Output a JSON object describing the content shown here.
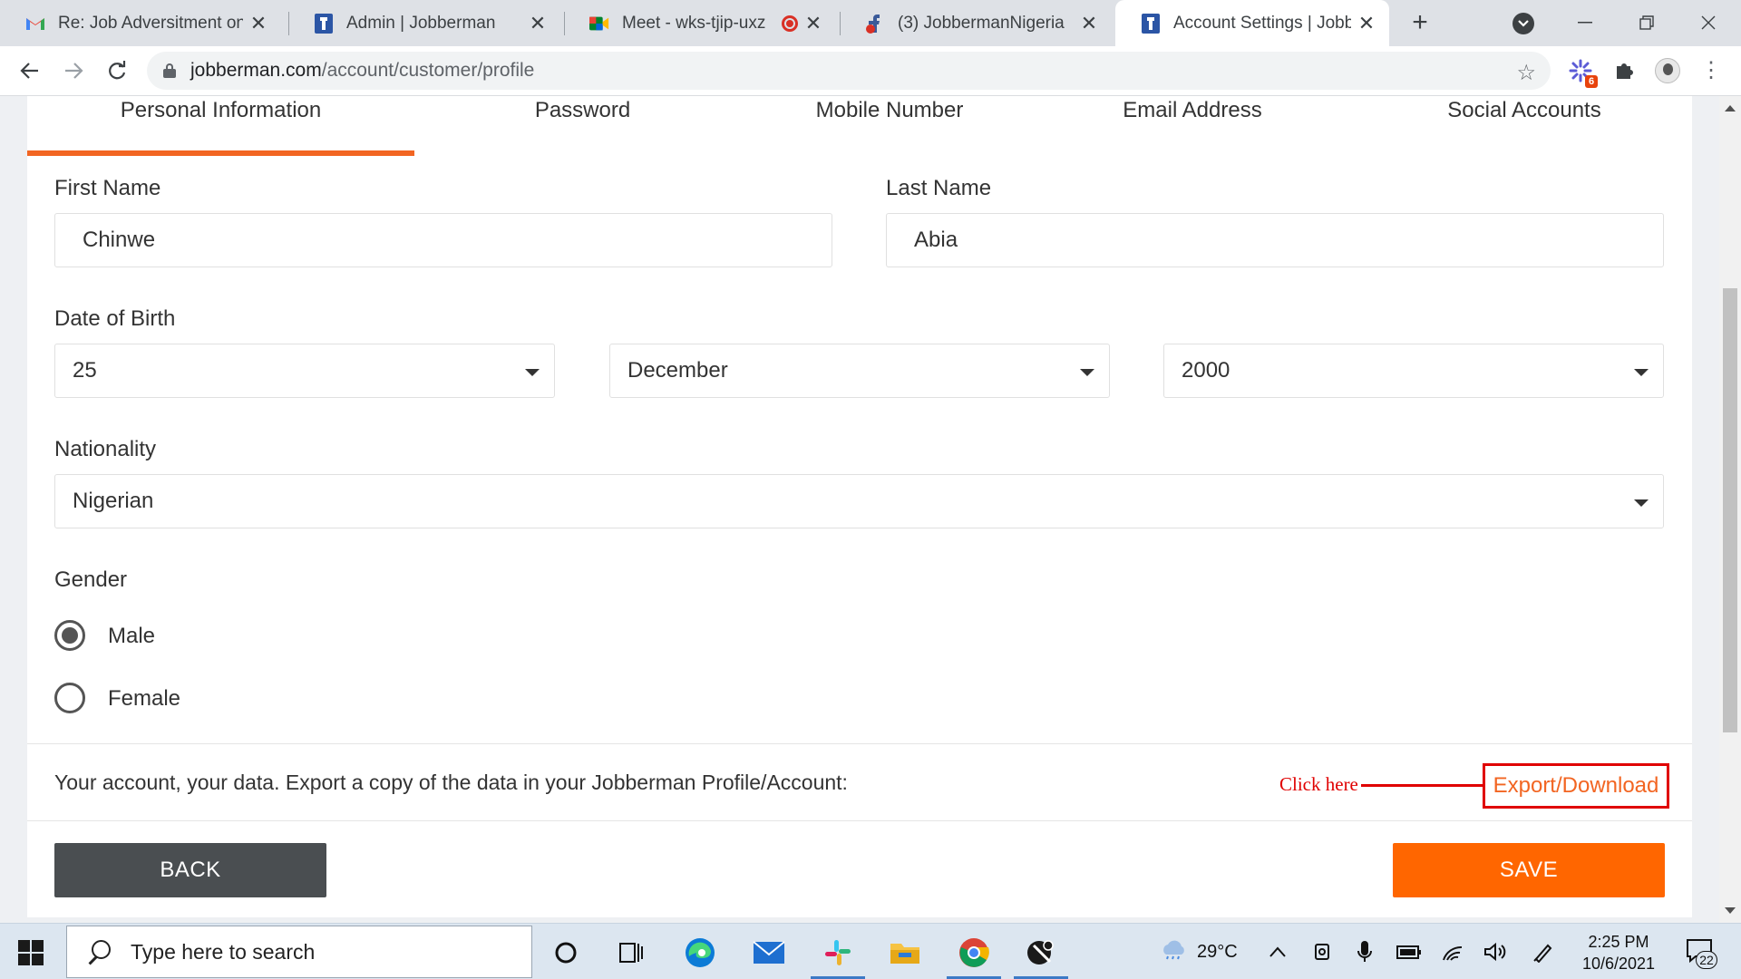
{
  "browser": {
    "tabs": [
      {
        "title": "Re: Job Adversitment on N",
        "favicon": "gmail-icon"
      },
      {
        "title": "Admin | Jobberman",
        "favicon": "jobberman-icon"
      },
      {
        "title": "Meet - wks-tjip-uxz",
        "favicon": "google-meet-icon"
      },
      {
        "title": "(3) JobbermanNigeria",
        "favicon": "facebook-icon"
      },
      {
        "title": "Account Settings | Jobberr",
        "favicon": "jobberman-icon"
      }
    ],
    "url_host": "jobberman.com",
    "url_path": "/account/customer/profile",
    "extension_badge": "6"
  },
  "profile": {
    "tabs": [
      {
        "label": "Personal Information"
      },
      {
        "label": "Password"
      },
      {
        "label": "Mobile Number"
      },
      {
        "label": "Email Address"
      },
      {
        "label": "Social Accounts"
      }
    ],
    "first_name": {
      "label": "First Name",
      "value": "Chinwe"
    },
    "last_name": {
      "label": "Last Name",
      "value": "Abia"
    },
    "dob": {
      "label": "Date of Birth",
      "day": "25",
      "month": "December",
      "year": "2000"
    },
    "nationality": {
      "label": "Nationality",
      "value": "Nigerian"
    },
    "gender": {
      "label": "Gender",
      "options": [
        "Male",
        "Female"
      ],
      "selected": "Male"
    },
    "export": {
      "text": "Your account, your data. Export a copy of the data in your Jobberman Profile/Account:",
      "link_label": "Export/Download",
      "annotation": "Click here"
    },
    "back_label": "BACK",
    "save_label": "SAVE"
  },
  "colors": {
    "accent": "#f26522",
    "save": "#ff6600",
    "back": "#4a4e51",
    "annotation": "#e00000"
  },
  "taskbar": {
    "search_placeholder": "Type here to search",
    "temperature": "29°C",
    "time": "2:25 PM",
    "date": "10/6/2021",
    "notification_count": "22"
  }
}
